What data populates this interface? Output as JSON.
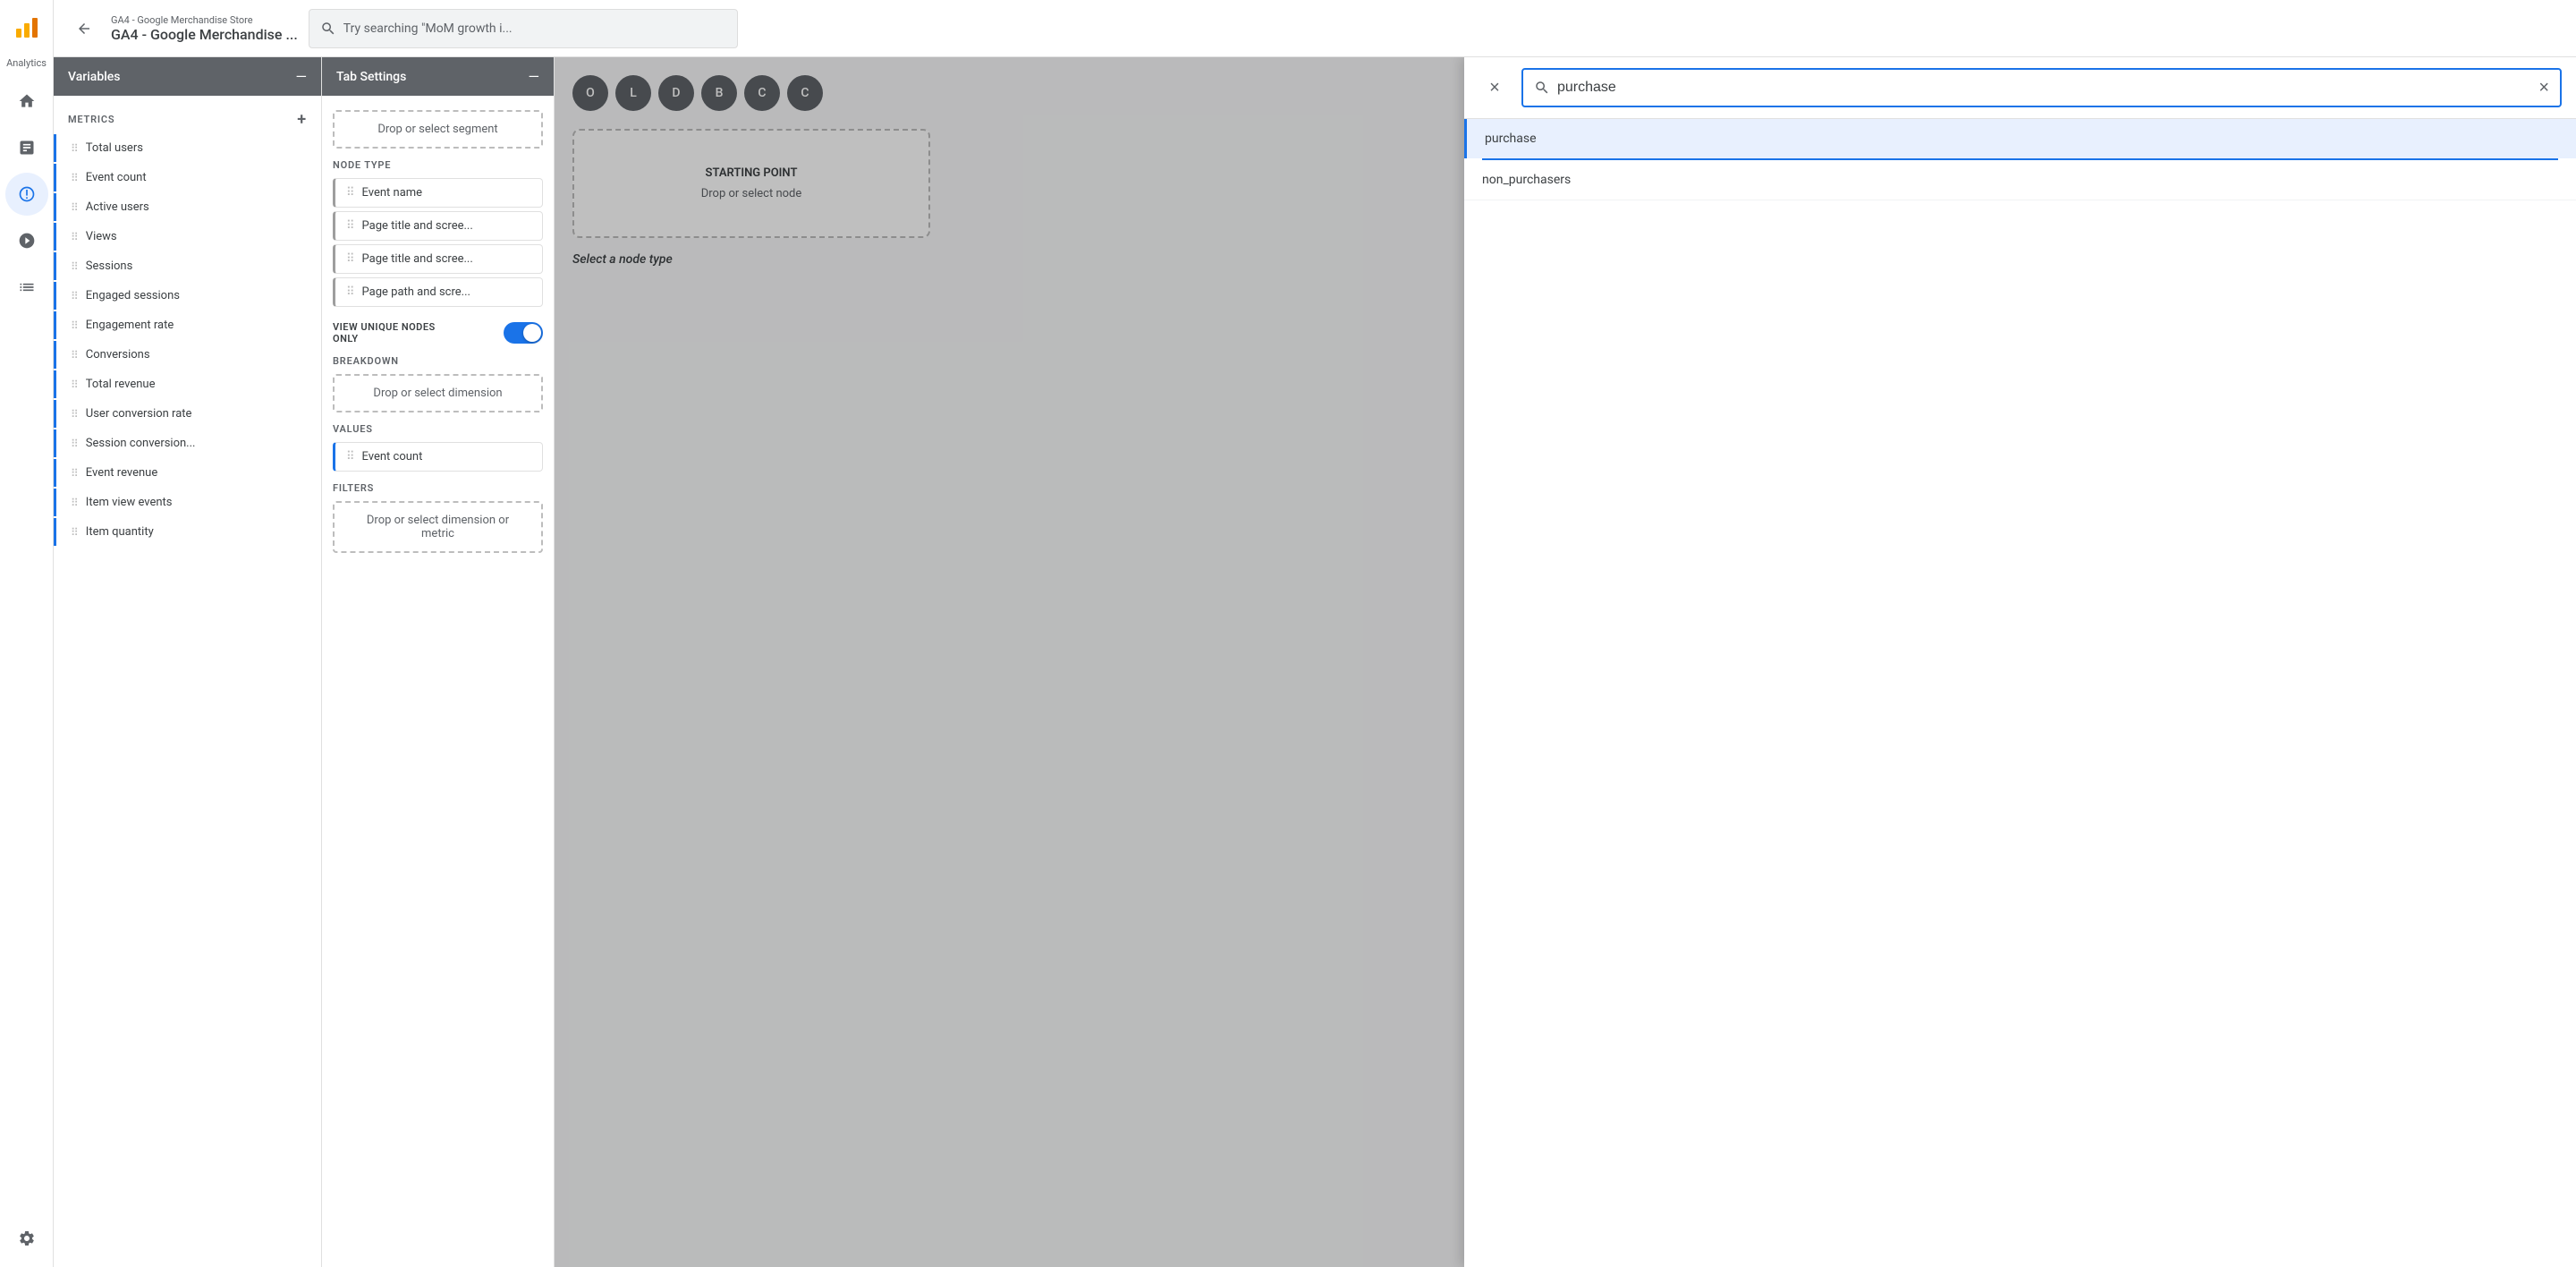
{
  "leftNav": {
    "items": [
      {
        "id": "home",
        "icon": "home",
        "active": false
      },
      {
        "id": "bar-chart",
        "icon": "bar-chart",
        "active": false
      },
      {
        "id": "explore",
        "icon": "explore",
        "active": true
      },
      {
        "id": "funnel",
        "icon": "funnel",
        "active": false
      },
      {
        "id": "list",
        "icon": "list",
        "active": false
      }
    ],
    "bottomItems": [
      {
        "id": "settings",
        "icon": "settings"
      }
    ]
  },
  "header": {
    "propertySubLabel": "GA4 - Google Merchandise Store",
    "propertyName": "GA4 - Google Merchandise ...",
    "searchPlaceholder": "Try searching \"MoM growth i...",
    "backLabel": "back"
  },
  "variablesPanel": {
    "title": "Variables",
    "minimizeLabel": "—",
    "sectionLabel": "METRICS",
    "addLabel": "+",
    "metrics": [
      {
        "name": "Total users"
      },
      {
        "name": "Event count"
      },
      {
        "name": "Active users"
      },
      {
        "name": "Views"
      },
      {
        "name": "Sessions"
      },
      {
        "name": "Engaged sessions"
      },
      {
        "name": "Engagement rate"
      },
      {
        "name": "Conversions"
      },
      {
        "name": "Total revenue"
      },
      {
        "name": "User conversion rate"
      },
      {
        "name": "Session conversion..."
      },
      {
        "name": "Event revenue"
      },
      {
        "name": "Item view events"
      },
      {
        "name": "Item quantity"
      }
    ]
  },
  "tabSettingsPanel": {
    "title": "Tab Settings",
    "minimizeLabel": "—",
    "segmentLabel": "Drop or select segment",
    "nodeTypeLabel": "NODE TYPE",
    "nodeTypes": [
      {
        "name": "Event name"
      },
      {
        "name": "Page title and scree..."
      },
      {
        "name": "Page title and scree..."
      },
      {
        "name": "Page path and scre..."
      }
    ],
    "viewUniqueNodesLabel": "VIEW UNIQUE NODES\nONLY",
    "breakdownLabel": "BREAKDOWN",
    "dropDimensionLabel": "Drop or select dimension",
    "valuesLabel": "VALUES",
    "valueItem": "Event count",
    "filtersLabel": "FILTERS",
    "dropDimensionMetricLabel": "Drop or select dimension or metric"
  },
  "canvas": {
    "avatars": [
      {
        "label": "O",
        "bg": "#5f6368"
      },
      {
        "label": "L",
        "bg": "#5f6368"
      },
      {
        "label": "D",
        "bg": "#5f6368"
      },
      {
        "label": "B",
        "bg": "#5f6368"
      },
      {
        "label": "C",
        "bg": "#5f6368"
      },
      {
        "label": "C",
        "bg": "#5f6368"
      }
    ],
    "startingPointTitle": "STARTING POINT",
    "startingPointSubtext": "Drop or select node",
    "selectNodeText": "Select a node type"
  },
  "searchDialog": {
    "searchValue": "purchase",
    "results": [
      {
        "name": "purchase",
        "active": true
      },
      {
        "name": "non_purchasers",
        "active": false
      }
    ],
    "closeLabel": "×",
    "clearLabel": "×"
  }
}
